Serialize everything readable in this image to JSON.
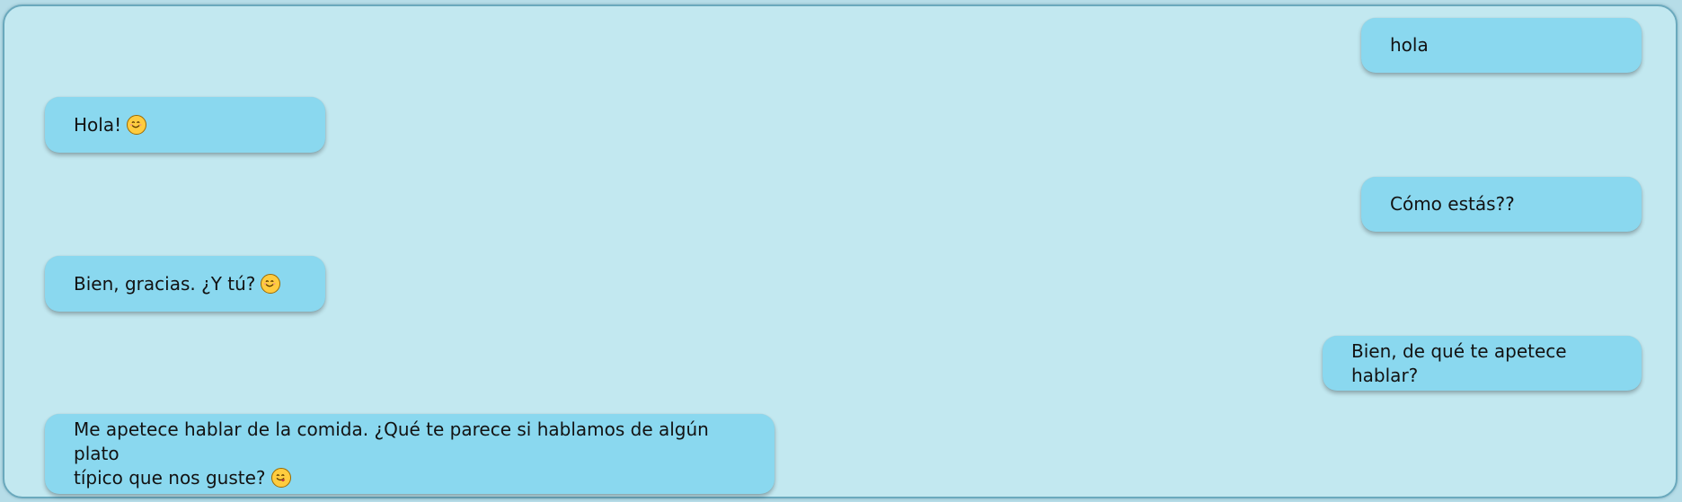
{
  "chat": {
    "messages": [
      {
        "sender": "user",
        "text": "hola",
        "emoji": ""
      },
      {
        "sender": "bot",
        "text": "Hola!",
        "emoji": "smiling-face-icon"
      },
      {
        "sender": "user",
        "text": "Cómo estás??",
        "emoji": ""
      },
      {
        "sender": "bot",
        "text": "Bien, gracias. ¿Y tú?",
        "emoji": "smiling-face-icon"
      },
      {
        "sender": "user",
        "text": "Bien, de qué te apetece hablar?",
        "emoji": ""
      },
      {
        "sender": "bot",
        "text": "Me apetece hablar de la comida. ¿Qué te parece si hablamos de algún plato\ntípico que nos guste?",
        "emoji": "yum-face-icon"
      }
    ]
  },
  "colors": {
    "background": "#c2e8f0",
    "bubble": "#8ad8ef",
    "border": "#6aa9bd",
    "text": "#121212"
  }
}
